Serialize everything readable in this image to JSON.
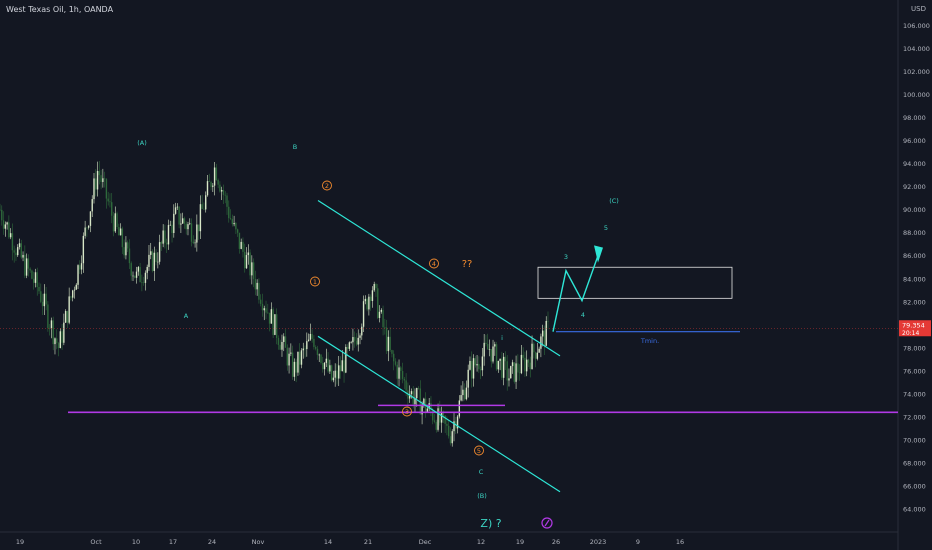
{
  "header": {
    "title": "West Texas Oil, 1h, OANDA",
    "currency": "USD"
  },
  "colors": {
    "background": "#131722",
    "candle_up": "#d8e7c8",
    "candle_down": "#2f6a3c",
    "channel": "#2ee6d6",
    "support": "#b139e6",
    "target_box": "#e6e6e6",
    "tmin_line": "#3a6ee6",
    "wave_cyan": "#3cd3c2",
    "wave_orange": "#f28a2e",
    "wave_yellow": "#e0b53a",
    "price_tag": "#e53935",
    "price_line": "#e53935"
  },
  "chart_data": {
    "type": "candlestick",
    "ylim": [
      62,
      107
    ],
    "y_ticks": [
      "64.000",
      "66.000",
      "68.000",
      "70.000",
      "72.000",
      "74.000",
      "76.000",
      "78.000",
      "80.000",
      "82.000",
      "84.000",
      "86.000",
      "88.000",
      "90.000",
      "92.000",
      "94.000",
      "96.000",
      "98.000",
      "100.000",
      "102.000",
      "104.000",
      "106.000"
    ],
    "x_ticks": [
      "19",
      "Oct",
      "10",
      "17",
      "24",
      "Nov",
      "14",
      "21",
      "Dec",
      "12",
      "19",
      "26",
      "2023",
      "9",
      "16"
    ],
    "last_price": "79.354",
    "countdown": "20:14",
    "price_path": [
      [
        0,
        90
      ],
      [
        0.04,
        86
      ],
      [
        0.08,
        83
      ],
      [
        0.12,
        78
      ],
      [
        0.16,
        85
      ],
      [
        0.2,
        93.5
      ],
      [
        0.24,
        88
      ],
      [
        0.28,
        84
      ],
      [
        0.32,
        86
      ],
      [
        0.36,
        89.5
      ],
      [
        0.4,
        88
      ],
      [
        0.44,
        93.8
      ],
      [
        0.48,
        88
      ],
      [
        0.52,
        84
      ],
      [
        0.56,
        80
      ],
      [
        0.6,
        76
      ],
      [
        0.64,
        79
      ],
      [
        0.68,
        75
      ],
      [
        0.72,
        78
      ],
      [
        0.76,
        83.5
      ],
      [
        0.8,
        77
      ],
      [
        0.84,
        74
      ],
      [
        0.88,
        72.5
      ],
      [
        0.92,
        70.5
      ],
      [
        0.96,
        76
      ],
      [
        1.0,
        78
      ],
      [
        1.04,
        75.5
      ],
      [
        1.08,
        77
      ],
      [
        1.12,
        79.5
      ]
    ],
    "annotations": [
      {
        "text": "(A)",
        "color": "wave_cyan"
      },
      {
        "text": "A",
        "color": "wave_cyan"
      },
      {
        "text": "B",
        "color": "wave_cyan"
      },
      {
        "text": "1",
        "color": "wave_orange",
        "circled": true
      },
      {
        "text": "2",
        "color": "wave_orange",
        "circled": true
      },
      {
        "text": "3",
        "color": "wave_orange",
        "circled": true
      },
      {
        "text": "4",
        "color": "wave_orange",
        "circled": true
      },
      {
        "text": "5",
        "color": "wave_orange",
        "circled": true
      },
      {
        "text": "??",
        "color": "wave_orange"
      },
      {
        "text": "i",
        "color": "wave_cyan"
      },
      {
        "text": "C",
        "color": "wave_cyan"
      },
      {
        "text": "(B)",
        "color": "wave_cyan"
      },
      {
        "text": "Z) ?",
        "color": "wave_cyan"
      },
      {
        "text": "3",
        "color": "wave_cyan"
      },
      {
        "text": "4",
        "color": "wave_cyan"
      },
      {
        "text": "5",
        "color": "wave_cyan"
      },
      {
        "text": "(C)",
        "color": "wave_cyan"
      },
      {
        "text": "Tmin.",
        "color": "tmin_line"
      }
    ],
    "levels": {
      "support": 72.4,
      "support_short": 73.0,
      "tmin": 79.4,
      "target_box": [
        82.3,
        85.0
      ],
      "price_line": 79.7
    }
  }
}
